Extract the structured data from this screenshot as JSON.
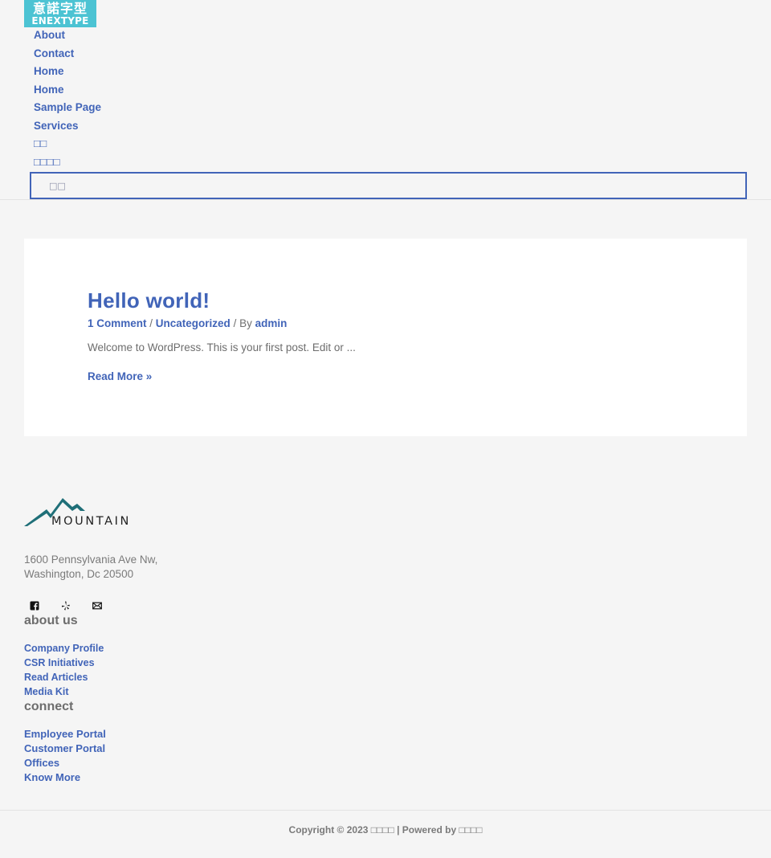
{
  "header": {
    "logo": {
      "cjk_text": "意諾字型",
      "en_text": "ENEXTYPE"
    },
    "nav": [
      {
        "label": "About"
      },
      {
        "label": "Contact"
      },
      {
        "label": "Home"
      },
      {
        "label": "Home"
      },
      {
        "label": "Sample Page"
      },
      {
        "label": "Services"
      },
      {
        "label": "□□"
      },
      {
        "label": "□□□□"
      }
    ],
    "search": {
      "placeholder": "□□"
    }
  },
  "post": {
    "title": "Hello world!",
    "meta": {
      "comments": "1 Comment",
      "separator1": " / ",
      "category": "Uncategorized",
      "by": " / By ",
      "author": "admin"
    },
    "excerpt": "Welcome to WordPress. This is your first post. Edit or ...",
    "read_more": "Read More »"
  },
  "footer": {
    "brand_logo_text": "MOUNTAIN",
    "address_line1": "1600 Pennsylvania Ave Nw,",
    "address_line2": "Washington, Dc 20500",
    "social_icons": [
      "facebook-icon",
      "yelp-icon",
      "mail-icon"
    ],
    "about": {
      "title": "about us",
      "links": [
        {
          "label": "Company Profile"
        },
        {
          "label": "CSR Initiatives"
        },
        {
          "label": "Read Articles"
        },
        {
          "label": "Media Kit"
        }
      ]
    },
    "connect": {
      "title": "connect",
      "links": [
        {
          "label": "Employee Portal"
        },
        {
          "label": "Customer Portal"
        },
        {
          "label": "Offices"
        },
        {
          "label": "Know More"
        }
      ]
    },
    "copyright": "Copyright © 2023 □□□□ | Powered by □□□□"
  },
  "colors": {
    "accent": "#4164b8",
    "logo_bg": "#4cc3d3",
    "mountain": "#1f6f78",
    "page_bg": "#f5f5f5",
    "card_bg": "#ffffff"
  }
}
